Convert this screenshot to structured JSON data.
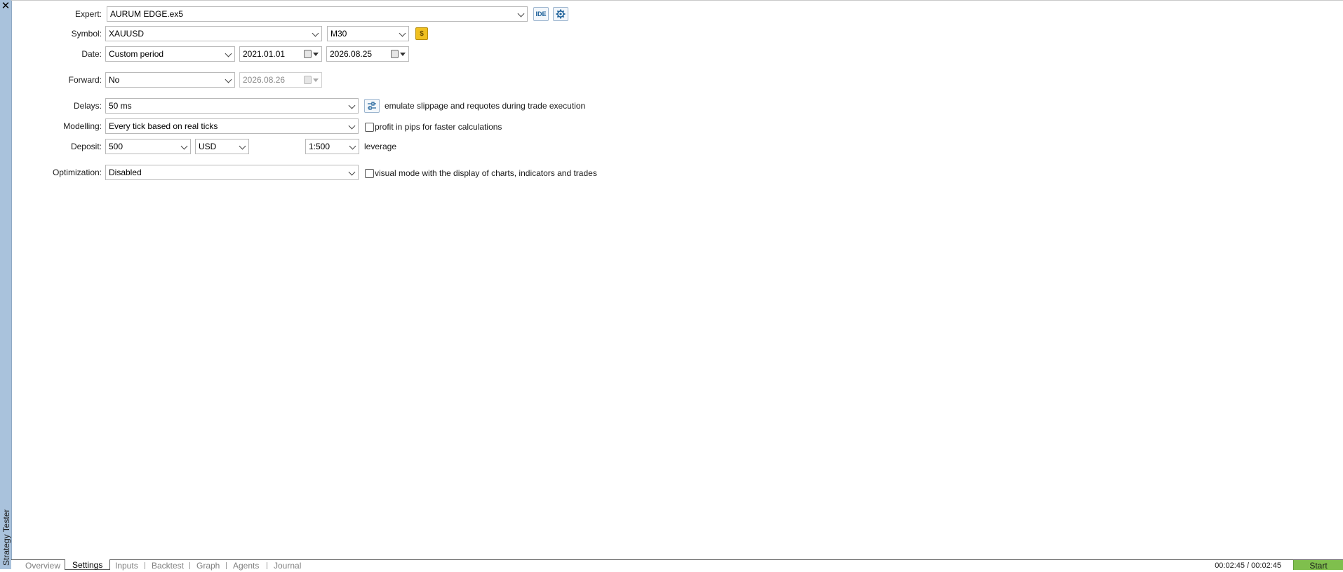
{
  "window": {
    "close_glyph": "✕",
    "panel_title": "Strategy Tester"
  },
  "settings": {
    "expert": {
      "label": "Expert:",
      "value": "AURUM EDGE.ex5",
      "ide_label": "IDE"
    },
    "symbol": {
      "label": "Symbol:",
      "value": "XAUUSD",
      "timeframe": "M30",
      "coin_glyph": "$"
    },
    "date": {
      "label": "Date:",
      "period": "Custom period",
      "from": "2021.01.01",
      "to": "2026.08.25"
    },
    "forward": {
      "label": "Forward:",
      "value": "No",
      "date": "2026.08.26"
    },
    "delays": {
      "label": "Delays:",
      "value": "50 ms",
      "note": "emulate slippage and requotes during trade execution"
    },
    "modelling": {
      "label": "Modelling:",
      "value": "Every tick based on real ticks",
      "checkbox_label": "profit in pips for faster calculations"
    },
    "deposit": {
      "label": "Deposit:",
      "amount": "500",
      "currency": "USD",
      "leverage": "1:500",
      "leverage_label": "leverage"
    },
    "optimization": {
      "label": "Optimization:",
      "value": "Disabled",
      "checkbox_label": "visual mode with the display of charts, indicators and trades"
    }
  },
  "tabs": [
    {
      "label": "Overview"
    },
    {
      "label": "Settings"
    },
    {
      "label": "Inputs"
    },
    {
      "label": "Backtest"
    },
    {
      "label": "Graph"
    },
    {
      "label": "Agents"
    },
    {
      "label": "Journal"
    }
  ],
  "status": {
    "timer": "00:02:45 / 00:02:45",
    "start_label": "Start"
  },
  "colors": {
    "accent": "#1b5f99",
    "start": "#7fbf4d",
    "side_strip": "#a9c2dc"
  },
  "icons": {
    "ide": "ide-icon",
    "settings": "gear-icon",
    "coin": "coin-icon",
    "delays": "sliders-icon"
  }
}
